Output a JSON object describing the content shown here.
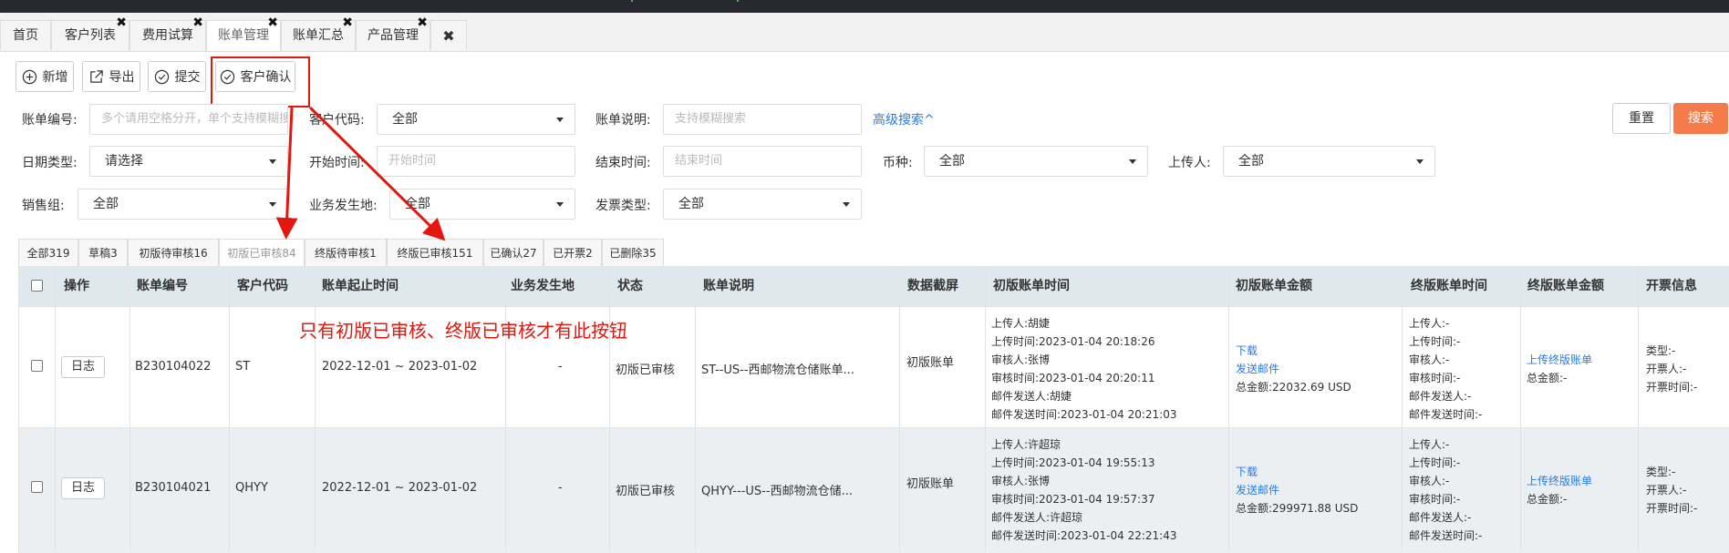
{
  "tabs": [
    {
      "label": "首页",
      "closable": false
    },
    {
      "label": "客户列表",
      "closable": true
    },
    {
      "label": "费用试算",
      "closable": true
    },
    {
      "label": "账单管理",
      "closable": true,
      "active": true
    },
    {
      "label": "账单汇总",
      "closable": true
    },
    {
      "label": "产品管理",
      "closable": true
    }
  ],
  "tab_close_all": "✖",
  "toolbar": {
    "add": "新增",
    "export": "导出",
    "submit": "提交",
    "confirm": "客户确认"
  },
  "filters": {
    "bill_no_label": "账单编号:",
    "bill_no_placeholder": "多个请用空格分开，单个支持模糊搜索",
    "customer_code_label": "客户代码:",
    "customer_code_value": "全部",
    "bill_desc_label": "账单说明:",
    "bill_desc_placeholder": "支持模糊搜索",
    "advanced_search": "高级搜索^",
    "date_type_label": "日期类型:",
    "date_type_value": "请选择",
    "start_label": "开始时间:",
    "start_placeholder": "开始时间",
    "end_label": "结束时间:",
    "end_placeholder": "结束时间",
    "currency_label": "币种:",
    "currency_value": "全部",
    "uploader_label": "上传人:",
    "uploader_value": "全部",
    "sales_group_label": "销售组:",
    "sales_group_value": "全部",
    "biz_place_label": "业务发生地:",
    "biz_place_value": "全部",
    "invoice_type_label": "发票类型:",
    "invoice_type_value": "全部",
    "reset": "重置",
    "search": "搜索"
  },
  "status_tabs": [
    "全部319",
    "草稿3",
    "初版待审核16",
    "初版已审核84",
    "终版待审核1",
    "终版已审核151",
    "已确认27",
    "已开票2",
    "已删除35"
  ],
  "active_status_tab": "初版已审核84",
  "annotation": "只有初版已审核、终版已审核才有此按钮",
  "table": {
    "headers": [
      "操作",
      "账单编号",
      "客户代码",
      "账单起止时间",
      "业务发生地",
      "状态",
      "账单说明",
      "数据截屏",
      "初版账单时间",
      "初版账单金额",
      "终版账单时间",
      "终版账单金额",
      "开票信息"
    ],
    "rows": [
      {
        "log": "日志",
        "bill_no": "B230104022",
        "customer": "ST",
        "period": "2022-12-01 ~ 2023-01-02",
        "place": "-",
        "status": "初版已审核",
        "desc": "ST--US--西邮物流仓储账单...",
        "screenshot": "初版账单",
        "first_time": [
          "上传人:胡婕",
          "上传时间:2023-01-04 20:18:26",
          "审核人:张博",
          "审核时间:2023-01-04 20:20:11",
          "邮件发送人:胡婕",
          "邮件发送时间:2023-01-04 20:21:03"
        ],
        "first_amount_links": [
          "下载",
          "发送邮件"
        ],
        "first_amount_total": "总金额:22032.69 USD",
        "final_time": [
          "上传人:-",
          "上传时间:-",
          "审核人:-",
          "审核时间:-",
          "邮件发送人:-",
          "邮件发送时间:-"
        ],
        "final_amount_link": "上传终版账单",
        "final_amount_total": "总金额:-",
        "invoice": [
          "类型:-",
          "开票人:-",
          "开票时间:-"
        ]
      },
      {
        "log": "日志",
        "bill_no": "B230104021",
        "customer": "QHYY",
        "period": "2022-12-01 ~ 2023-01-02",
        "place": "-",
        "status": "初版已审核",
        "desc": "QHYY---US--西邮物流仓储...",
        "screenshot": "初版账单",
        "first_time": [
          "上传人:许超琼",
          "上传时间:2023-01-04 19:55:13",
          "审核人:张博",
          "审核时间:2023-01-04 19:57:37",
          "邮件发送人:许超琼",
          "邮件发送时间:2023-01-04 22:21:43"
        ],
        "first_amount_links": [
          "下载",
          "发送邮件"
        ],
        "first_amount_total": "总金额:299971.88 USD",
        "final_time": [
          "上传人:-",
          "上传时间:-",
          "审核人:-",
          "审核时间:-",
          "邮件发送人:-",
          "邮件发送时间:-"
        ],
        "final_amount_link": "上传终版账单",
        "final_amount_total": "总金额:-",
        "invoice": [
          "类型:-",
          "开票人:-",
          "开票时间:-"
        ]
      }
    ]
  },
  "colors": {
    "accent": "#2a7ae2",
    "search_button": "#f47b4a",
    "annotation": "#e3170d",
    "header_bg": "#dfe8ed"
  }
}
